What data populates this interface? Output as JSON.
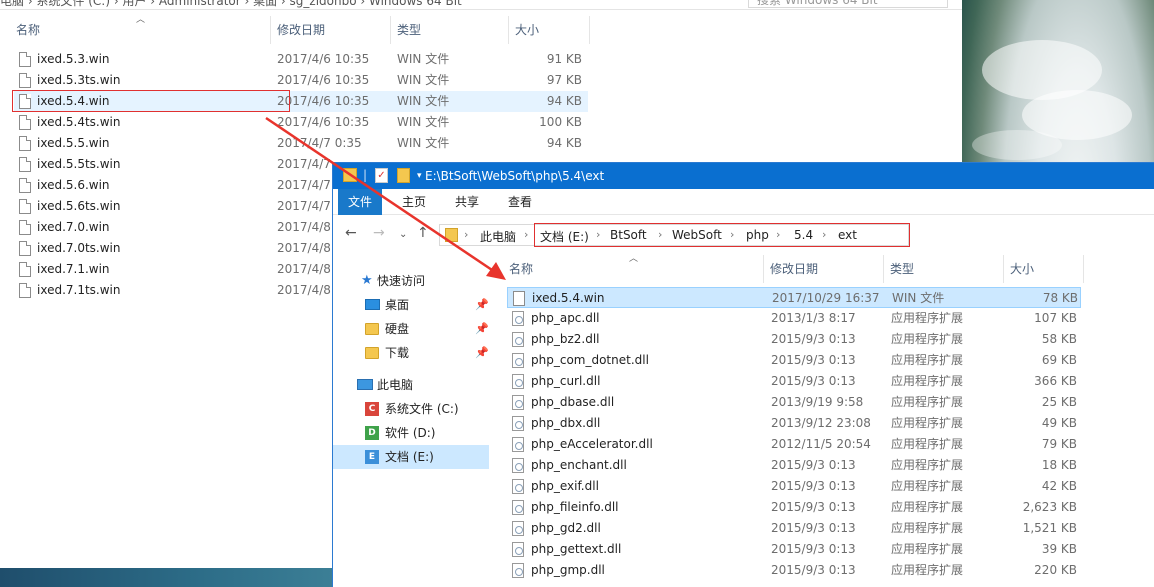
{
  "back_window": {
    "breadcrumb_text": "电脑 › 系统文件 (C:) › 用户 › Administrator › 桌面 › sg_zidonbo › Windows 64 Bit",
    "search_placeholder": "搜索 Windows 64 Bit",
    "headers": {
      "name": "名称",
      "date": "修改日期",
      "type": "类型",
      "size": "大小"
    },
    "files": [
      {
        "name": "ixed.5.3.win",
        "date": "2017/4/6 10:35",
        "type": "WIN 文件",
        "size": "91 KB"
      },
      {
        "name": "ixed.5.3ts.win",
        "date": "2017/4/6 10:35",
        "type": "WIN 文件",
        "size": "97 KB"
      },
      {
        "name": "ixed.5.4.win",
        "date": "2017/4/6 10:35",
        "type": "WIN 文件",
        "size": "94 KB"
      },
      {
        "name": "ixed.5.4ts.win",
        "date": "2017/4/6 10:35",
        "type": "WIN 文件",
        "size": "100 KB"
      },
      {
        "name": "ixed.5.5.win",
        "date": "2017/4/7 0:35",
        "type": "WIN 文件",
        "size": "94 KB"
      },
      {
        "name": "ixed.5.5ts.win",
        "date": "2017/4/7",
        "type": "",
        "size": ""
      },
      {
        "name": "ixed.5.6.win",
        "date": "2017/4/7",
        "type": "",
        "size": ""
      },
      {
        "name": "ixed.5.6ts.win",
        "date": "2017/4/7",
        "type": "",
        "size": ""
      },
      {
        "name": "ixed.7.0.win",
        "date": "2017/4/8",
        "type": "",
        "size": ""
      },
      {
        "name": "ixed.7.0ts.win",
        "date": "2017/4/8",
        "type": "",
        "size": ""
      },
      {
        "name": "ixed.7.1.win",
        "date": "2017/4/8",
        "type": "",
        "size": ""
      },
      {
        "name": "ixed.7.1ts.win",
        "date": "2017/4/8",
        "type": "",
        "size": ""
      }
    ]
  },
  "front_window": {
    "title": "E:\\BtSoft\\WebSoft\\php\\5.4\\ext",
    "ribbon_tabs": [
      "文件",
      "主页",
      "共享",
      "查看"
    ],
    "address": {
      "root": "此电脑",
      "parts": [
        "文档 (E:)",
        "BtSoft",
        "WebSoft",
        "php",
        "5.4",
        "ext"
      ]
    },
    "nav": {
      "quick_access": "快速访问",
      "pinned": [
        "桌面",
        "硬盘",
        "下载"
      ],
      "this_pc": "此电脑",
      "drives": [
        {
          "letter": "C",
          "label": "系统文件 (C:)",
          "color": "#d9453b"
        },
        {
          "letter": "D",
          "label": "软件 (D:)",
          "color": "#3fa24a"
        },
        {
          "letter": "E",
          "label": "文档 (E:)",
          "color": "#3b8fd9"
        }
      ]
    },
    "headers": {
      "name": "名称",
      "date": "修改日期",
      "type": "类型",
      "size": "大小"
    },
    "files": [
      {
        "name": "ixed.5.4.win",
        "date": "2017/10/29 16:37",
        "type": "WIN 文件",
        "size": "78 KB"
      },
      {
        "name": "php_apc.dll",
        "date": "2013/1/3 8:17",
        "type": "应用程序扩展",
        "size": "107 KB"
      },
      {
        "name": "php_bz2.dll",
        "date": "2015/9/3 0:13",
        "type": "应用程序扩展",
        "size": "58 KB"
      },
      {
        "name": "php_com_dotnet.dll",
        "date": "2015/9/3 0:13",
        "type": "应用程序扩展",
        "size": "69 KB"
      },
      {
        "name": "php_curl.dll",
        "date": "2015/9/3 0:13",
        "type": "应用程序扩展",
        "size": "366 KB"
      },
      {
        "name": "php_dbase.dll",
        "date": "2013/9/19 9:58",
        "type": "应用程序扩展",
        "size": "25 KB"
      },
      {
        "name": "php_dbx.dll",
        "date": "2013/9/12 23:08",
        "type": "应用程序扩展",
        "size": "49 KB"
      },
      {
        "name": "php_eAccelerator.dll",
        "date": "2012/11/5 20:54",
        "type": "应用程序扩展",
        "size": "79 KB"
      },
      {
        "name": "php_enchant.dll",
        "date": "2015/9/3 0:13",
        "type": "应用程序扩展",
        "size": "18 KB"
      },
      {
        "name": "php_exif.dll",
        "date": "2015/9/3 0:13",
        "type": "应用程序扩展",
        "size": "42 KB"
      },
      {
        "name": "php_fileinfo.dll",
        "date": "2015/9/3 0:13",
        "type": "应用程序扩展",
        "size": "2,623 KB"
      },
      {
        "name": "php_gd2.dll",
        "date": "2015/9/3 0:13",
        "type": "应用程序扩展",
        "size": "1,521 KB"
      },
      {
        "name": "php_gettext.dll",
        "date": "2015/9/3 0:13",
        "type": "应用程序扩展",
        "size": "39 KB"
      },
      {
        "name": "php_gmp.dll",
        "date": "2015/9/3 0:13",
        "type": "应用程序扩展",
        "size": "220 KB"
      }
    ]
  },
  "colors": {
    "accent": "#0a6fd0",
    "highlight_red": "#e03030",
    "arrow_red": "#e8342c"
  }
}
